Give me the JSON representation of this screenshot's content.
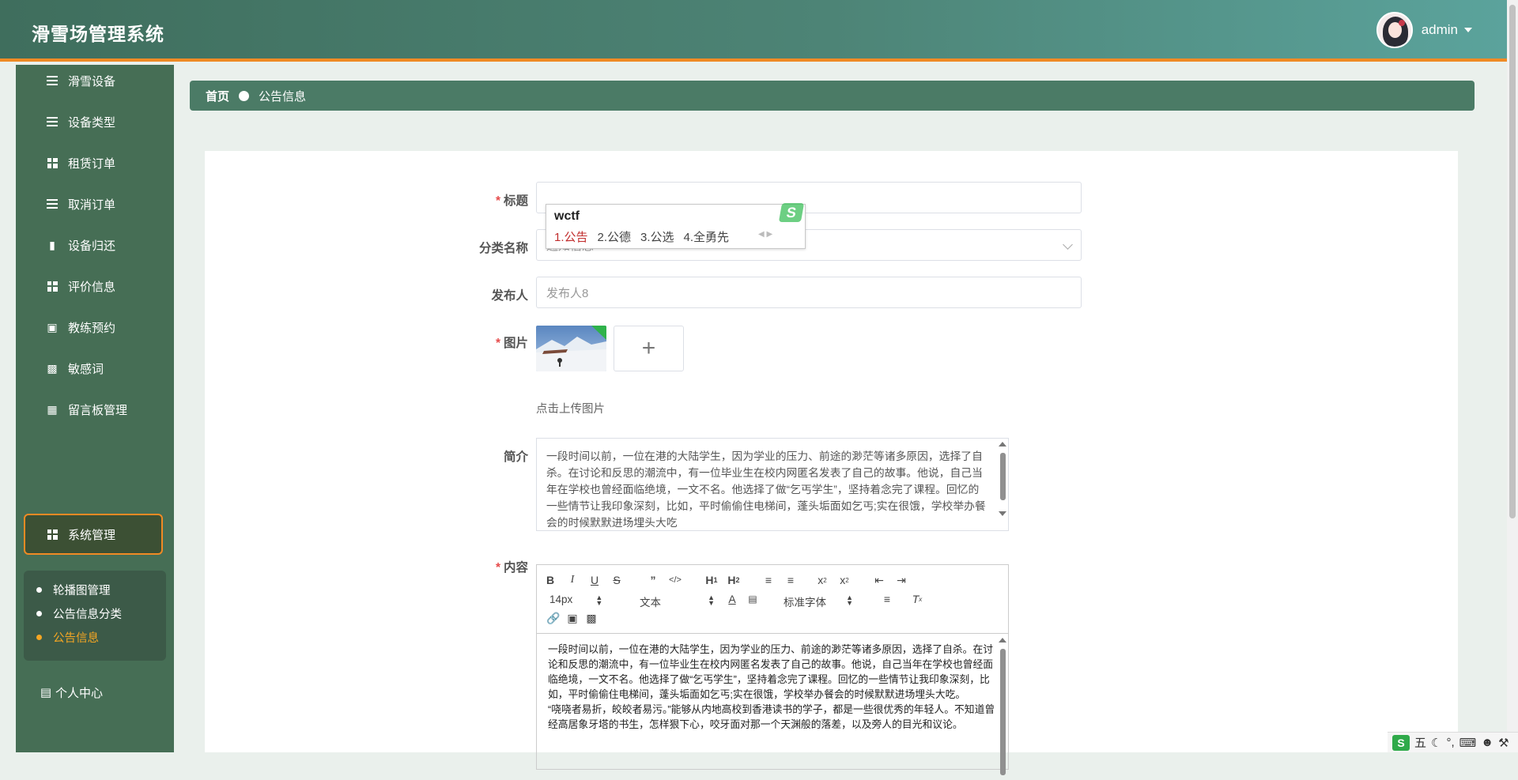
{
  "header": {
    "app_title": "滑雪场管理系统",
    "username": "admin"
  },
  "sidebar": {
    "items": [
      {
        "label": "滑雪设备",
        "icon": "sliders-icon"
      },
      {
        "label": "设备类型",
        "icon": "list-icon"
      },
      {
        "label": "租赁订单",
        "icon": "grid-icon"
      },
      {
        "label": "取消订单",
        "icon": "list-icon"
      },
      {
        "label": "设备归还",
        "icon": "chat-icon"
      },
      {
        "label": "评价信息",
        "icon": "grid-icon"
      },
      {
        "label": "教练预约",
        "icon": "clipboard-icon"
      },
      {
        "label": "敏感词",
        "icon": "folder-icon"
      },
      {
        "label": "留言板管理",
        "icon": "card-icon"
      },
      {
        "label": "系统管理",
        "icon": "grid-icon"
      }
    ],
    "sub_items": [
      {
        "label": "轮播图管理"
      },
      {
        "label": "公告信息分类"
      },
      {
        "label": "公告信息"
      }
    ],
    "personal_center": "个人中心"
  },
  "breadcrumb": {
    "home": "首页",
    "current": "公告信息"
  },
  "form": {
    "title_label": "标题",
    "title_value": "",
    "category_label": "分类名称",
    "category_value": "通知信息",
    "publisher_label": "发布人",
    "publisher_placeholder": "发布人8",
    "image_label": "图片",
    "upload_hint": "点击上传图片",
    "summary_label": "简介",
    "summary_text": "一段时间以前，一位在港的大陆学生，因为学业的压力、前途的渺茫等诸多原因，选择了自杀。在讨论和反思的潮流中，有一位毕业生在校内网匿名发表了自己的故事。他说，自己当年在学校也曾经面临绝境，一文不名。他选择了做“乞丐学生”，坚持着念完了课程。回忆的一些情节让我印象深刻，比如，平时偷偷住电梯间，蓬头垢面如乞丐;实在很饿，学校举办餐会的时候默默进场埋头大吃",
    "content_label": "内容"
  },
  "editor": {
    "font_size": "14px",
    "block_type": "文本",
    "font_family": "标准字体",
    "content_p1": "一段时间以前，一位在港的大陆学生，因为学业的压力、前途的渺茫等诸多原因，选择了自杀。在讨论和反思的潮流中，有一位毕业生在校内网匿名发表了自己的故事。他说，自己当年在学校也曾经面临绝境，一文不名。他选择了做“乞丐学生”，坚持着念完了课程。回忆的一些情节让我印象深刻，比如，平时偷偷住电梯间，蓬头垢面如乞丐;实在很饿，学校举办餐会的时候默默进场埋头大吃。",
    "content_p2": "“哓哓者易折，皎皎者易污。”能够从内地高校到香港读书的学子，都是一些很优秀的年轻人。不知道曾经高居象牙塔的书生，怎样狠下心，咬牙面对那一个天渊般的落差，以及旁人的目光和议论。"
  },
  "ime": {
    "input": "wctf",
    "candidates": [
      "1.公告",
      "2.公德",
      "3.公选",
      "4.全勇先"
    ]
  },
  "tray": {
    "mode": "五"
  },
  "colors": {
    "header_start": "#3f6e5d",
    "header_end": "#5ba39c",
    "accent": "#f08a24",
    "sidebar": "#466e55",
    "required": "#e64b4b"
  }
}
